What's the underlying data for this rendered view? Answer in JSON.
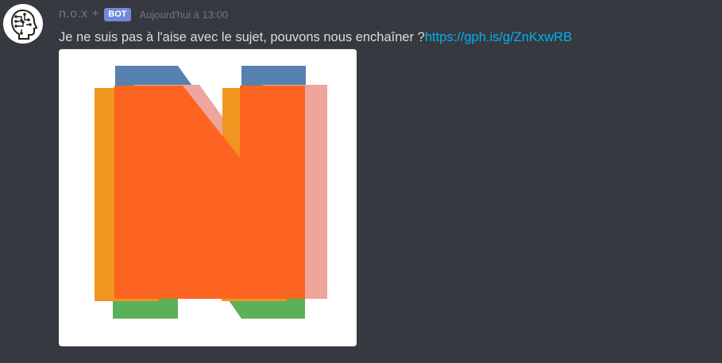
{
  "message": {
    "author": {
      "name": "n.o.x +",
      "badge": "BOT",
      "avatar_icon": "robot-head-circuit-icon"
    },
    "timestamp": "Aujourd'hui à 13:00",
    "text": "Je ne suis pas à l'aise avec le sujet, pouvons nous enchaîner ?",
    "link": "https://gph.is/g/ZnKxwRB",
    "embed": {
      "type": "gif",
      "description_icon": "letter-n-layered-icon",
      "colors": {
        "background": "#ffffff",
        "orange": "#fd6421",
        "yellow_orange": "#f0951f",
        "blue": "#5582ae",
        "pink": "#eea59b",
        "green": "#5bb05a"
      }
    }
  },
  "theme": {
    "background": "#36393f",
    "text": "#dcddde",
    "muted": "#72767d",
    "link": "#00b0f4",
    "badge": "#7289da"
  }
}
